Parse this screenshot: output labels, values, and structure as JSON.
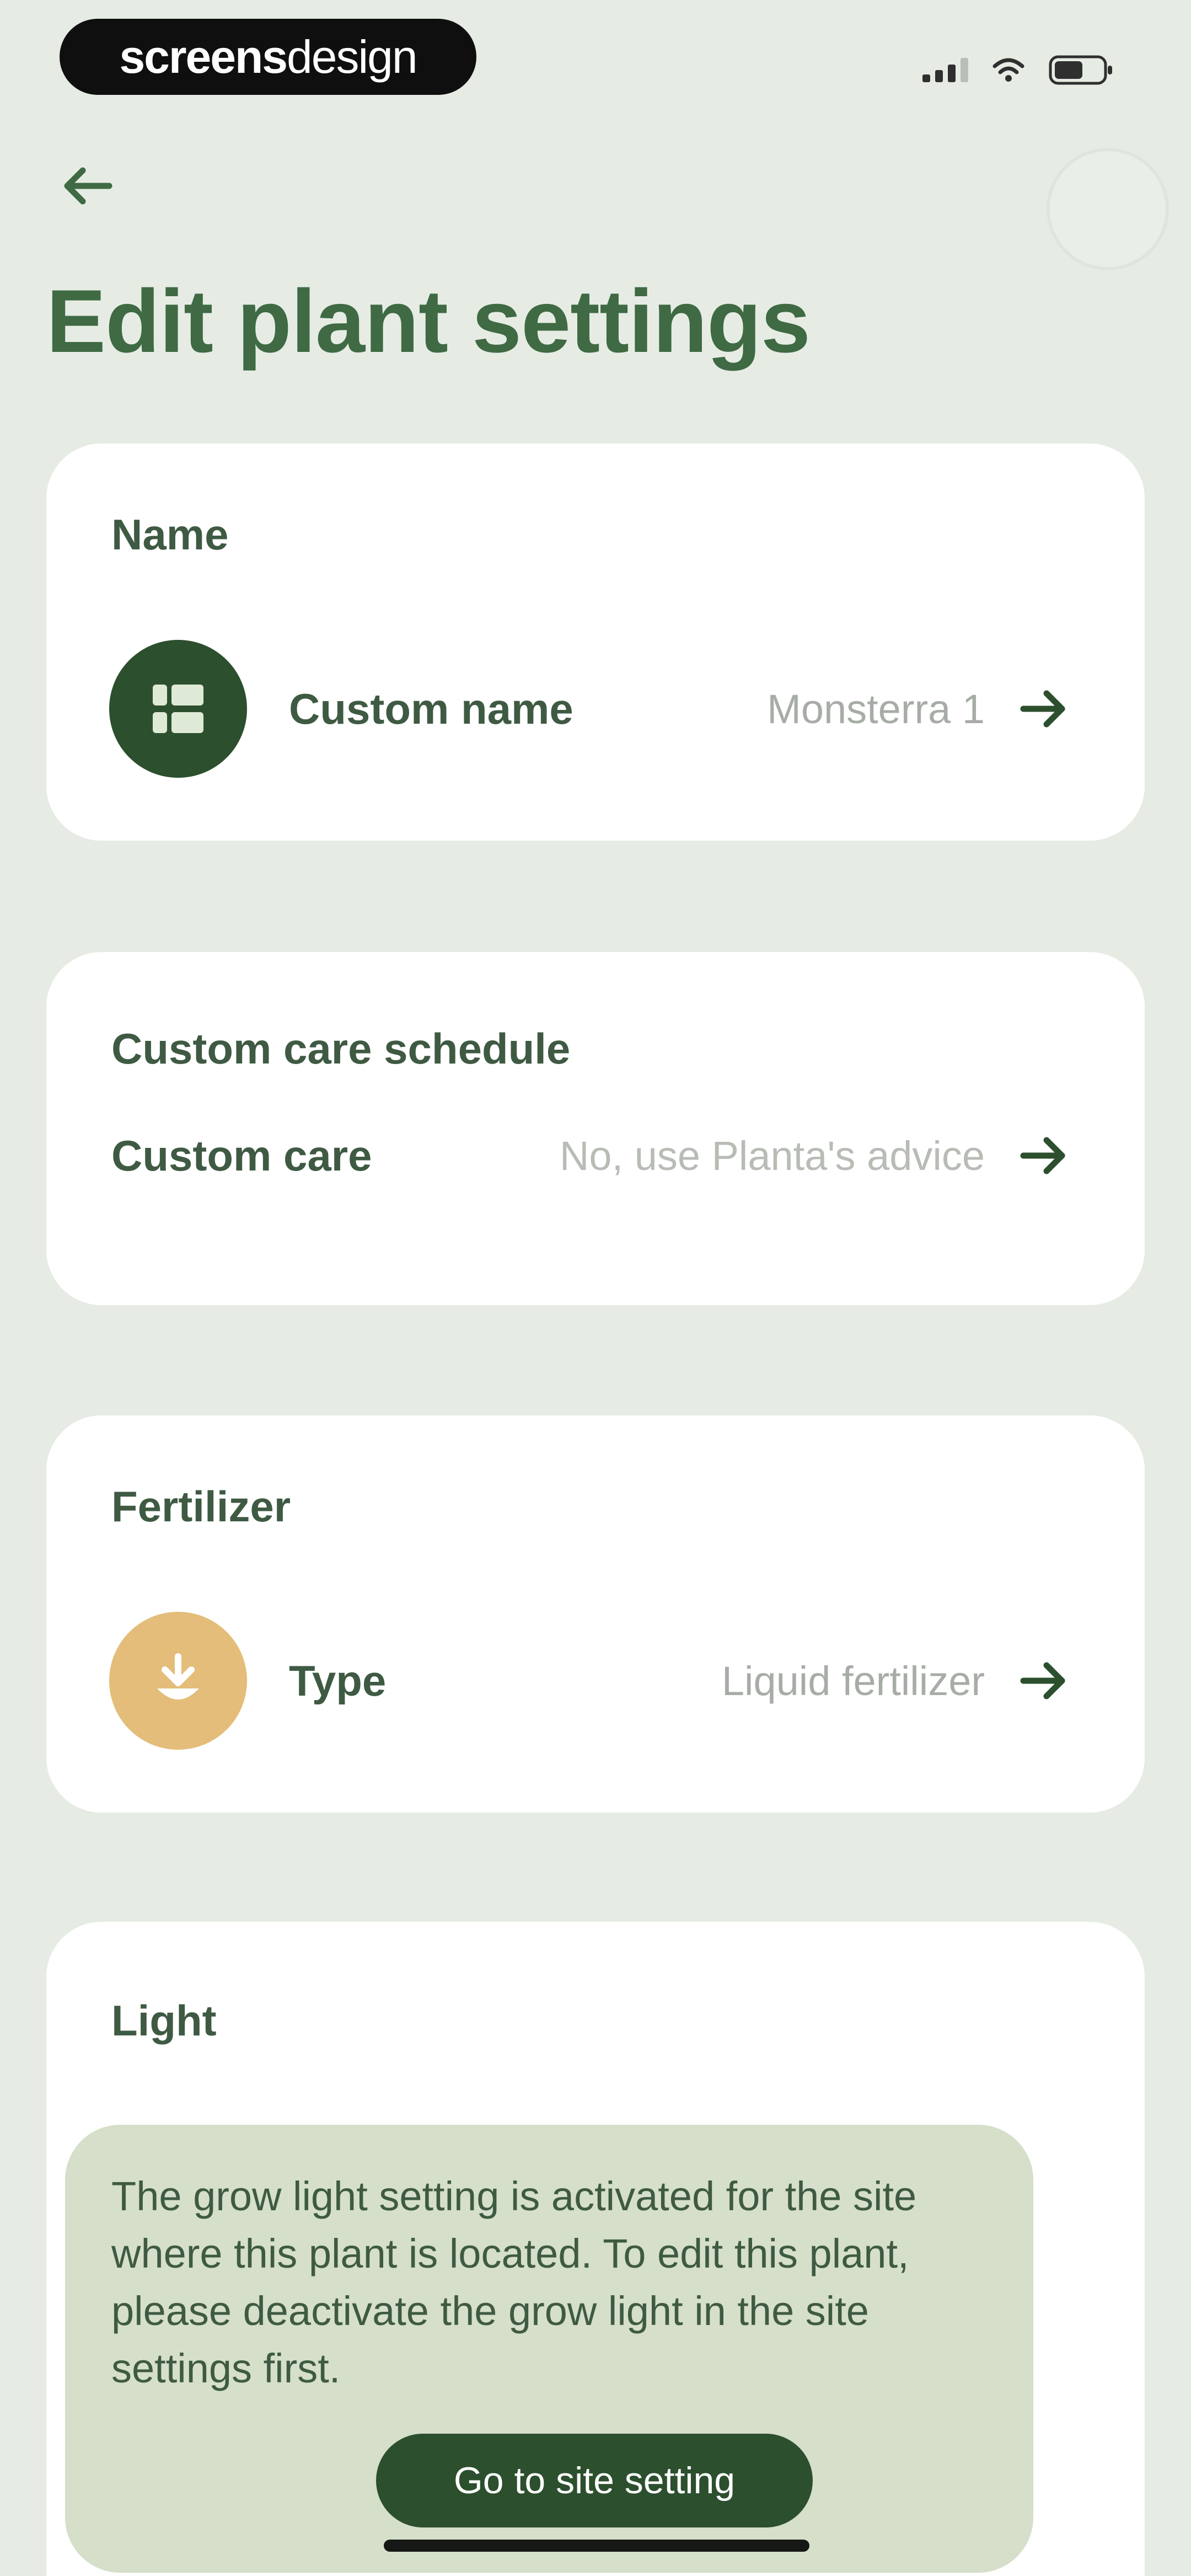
{
  "status_bar": {
    "brand_bold": "screens",
    "brand_light": "design",
    "signal_icon": "cellular-signal-icon",
    "wifi_icon": "wifi-icon",
    "battery_icon": "battery-icon"
  },
  "header": {
    "back_icon": "arrow-left-icon",
    "title": "Edit plant settings"
  },
  "sections": {
    "name": {
      "title": "Name",
      "row": {
        "icon": "plant-tag-icon",
        "label": "Custom name",
        "value": "Monsterra 1"
      }
    },
    "care": {
      "title": "Custom care schedule",
      "row": {
        "label": "Custom care",
        "value": "No, use Planta's advice"
      }
    },
    "fertilizer": {
      "title": "Fertilizer",
      "row": {
        "icon": "fertilizer-drop-icon",
        "label": "Type",
        "value": "Liquid fertilizer"
      }
    },
    "light": {
      "title": "Light",
      "notice": "The grow light setting is activated for the site where this plant is located. To edit this plant, please deactivate the grow light in the site settings first.",
      "button_label": "Go to site setting"
    }
  },
  "colors": {
    "background": "#e6ece4",
    "title_green": "#3f6a43",
    "dark_green": "#2c4f2e",
    "fertilizer_amber": "#e3bd79",
    "notice_bg": "#d5dfc9"
  }
}
